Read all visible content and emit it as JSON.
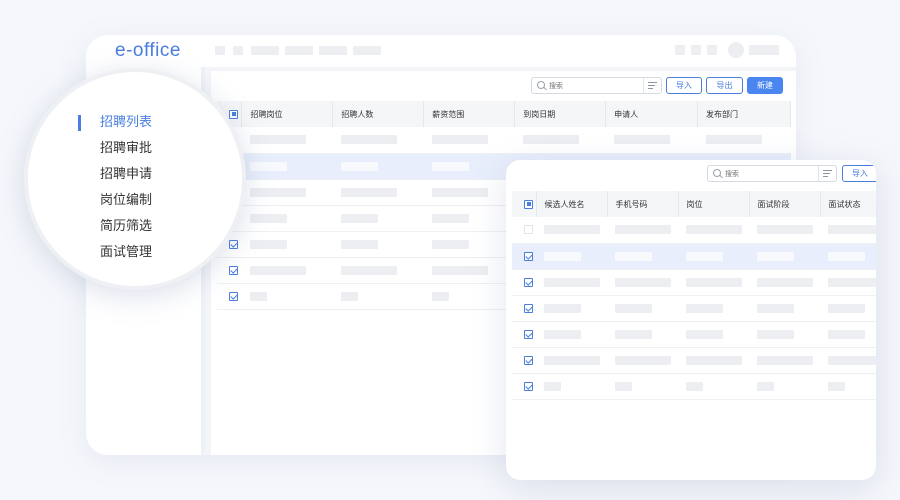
{
  "app": {
    "logo": "e-office"
  },
  "main_window": {
    "search_placeholder": "搜索",
    "buttons": {
      "import": "导入",
      "export": "导出",
      "create": "新建"
    },
    "table": {
      "columns": [
        "招聘岗位",
        "招聘人数",
        "薪资范围",
        "到岗日期",
        "申请人",
        "发布部门"
      ]
    }
  },
  "front_window": {
    "search_placeholder": "搜索",
    "buttons": {
      "import": "导入"
    },
    "table": {
      "columns": [
        "候选人姓名",
        "手机号码",
        "岗位",
        "面试阶段",
        "面试状态"
      ]
    }
  },
  "sidebar_menu": {
    "items": [
      {
        "label": "招聘列表",
        "active": true
      },
      {
        "label": "招聘审批",
        "active": false
      },
      {
        "label": "招聘申请",
        "active": false
      },
      {
        "label": "岗位编制",
        "active": false
      },
      {
        "label": "简历筛选",
        "active": false
      },
      {
        "label": "面试管理",
        "active": false
      }
    ]
  },
  "colors": {
    "accent": "#4a7dde",
    "primary_button": "#4a86f0",
    "selected_row": "#e8eefb"
  }
}
